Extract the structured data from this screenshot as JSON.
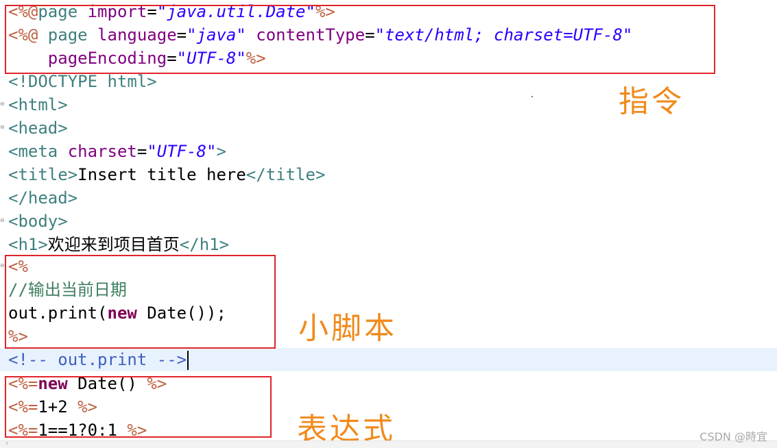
{
  "code_lines": [
    [
      [
        "c-dir",
        "<%@"
      ],
      [
        "c-tag",
        "page "
      ],
      [
        "c-attr",
        "import"
      ],
      [
        "c-txt",
        "="
      ],
      [
        "c-str",
        "\"java.util.Date\""
      ],
      [
        "c-dir",
        "%>"
      ]
    ],
    [
      [
        "c-dir",
        "<%@ "
      ],
      [
        "c-tag",
        "page "
      ],
      [
        "c-attr",
        "language"
      ],
      [
        "c-txt",
        "="
      ],
      [
        "c-str",
        "\"java\""
      ],
      [
        "c-txt",
        " "
      ],
      [
        "c-attr",
        "contentType"
      ],
      [
        "c-txt",
        "="
      ],
      [
        "c-str",
        "\"text/html; charset=UTF-8\""
      ]
    ],
    [
      [
        "c-txt",
        "    "
      ],
      [
        "c-attr",
        "pageEncoding"
      ],
      [
        "c-txt",
        "="
      ],
      [
        "c-str",
        "\"UTF-8\""
      ],
      [
        "c-dir",
        "%>"
      ]
    ],
    [
      [
        "c-tag",
        "<!DOCTYPE html>"
      ]
    ],
    [
      [
        "c-tag",
        "<html>"
      ]
    ],
    [
      [
        "c-tag",
        "<head>"
      ]
    ],
    [
      [
        "c-tag",
        "<meta "
      ],
      [
        "c-attr",
        "charset"
      ],
      [
        "c-txt",
        "="
      ],
      [
        "c-str",
        "\"UTF-8\""
      ],
      [
        "c-tag",
        ">"
      ]
    ],
    [
      [
        "c-tag",
        "<title>"
      ],
      [
        "c-txt",
        "Insert title here"
      ],
      [
        "c-tag",
        "</title>"
      ]
    ],
    [
      [
        "c-tag",
        "</head>"
      ]
    ],
    [
      [
        "c-tag",
        "<body>"
      ]
    ],
    [
      [
        "c-tag",
        "<h1>"
      ],
      [
        "c-txt",
        "欢迎来到项目首页"
      ],
      [
        "c-tag",
        "</h1>"
      ]
    ],
    [
      [
        "c-dir",
        "<%"
      ]
    ],
    [
      [
        "c-cmt",
        "//输出当前日期"
      ]
    ],
    [
      [
        "c-txt",
        "out.print("
      ],
      [
        "c-kw",
        "new"
      ],
      [
        "c-txt",
        " Date());"
      ]
    ],
    [
      [
        "c-dir",
        "%>"
      ]
    ],
    [
      [
        "c-hcmt",
        "<!-- out.print -->"
      ]
    ],
    [
      [
        "c-dir",
        "<%="
      ],
      [
        "c-kw",
        "new"
      ],
      [
        "c-txt",
        " Date() "
      ],
      [
        "c-dir",
        "%>"
      ]
    ],
    [
      [
        "c-dir",
        "<%="
      ],
      [
        "c-txt",
        "1+2 "
      ],
      [
        "c-dir",
        "%>"
      ]
    ],
    [
      [
        "c-dir",
        "<%="
      ],
      [
        "c-txt",
        "1==1?0:1 "
      ],
      [
        "c-dir",
        "%>"
      ]
    ]
  ],
  "annotations": {
    "directive": "指令",
    "scriptlet": "小脚本",
    "expression": "表达式"
  },
  "watermark": "CSDN @時宜",
  "colors": {
    "directive": "#bf5f3f",
    "tag": "#3f7f7f",
    "attribute": "#7f007f",
    "string": "#2a00ff",
    "keyword": "#7f0055",
    "comment": "#3f7f5f",
    "html_comment": "#3f5fbf",
    "highlight_box": "#e0242a",
    "annotation_text": "#f08a1c",
    "current_line": "#e8f2fe"
  }
}
